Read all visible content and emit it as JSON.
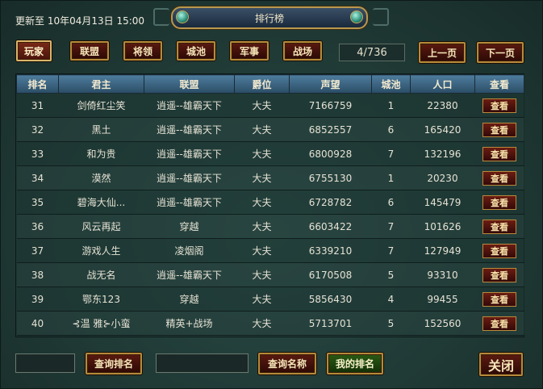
{
  "header": {
    "update_info": "更新至 10年04月13日 15:00",
    "title": "排行榜"
  },
  "tabs": [
    "玩家",
    "联盟",
    "将领",
    "城池",
    "军事",
    "战场"
  ],
  "active_tab": "玩家",
  "pagination": {
    "indicator": "4/736",
    "prev_label": "上一页",
    "next_label": "下一页"
  },
  "table": {
    "columns": [
      "排名",
      "君主",
      "联盟",
      "爵位",
      "声望",
      "城池",
      "人口",
      "查看"
    ],
    "view_label": "查看",
    "rows": [
      {
        "rank": "31",
        "lord": "剑倚红尘笑",
        "alliance": "逍遥--雄霸天下",
        "title": "大夫",
        "prestige": "7166759",
        "cities": "1",
        "population": "22380"
      },
      {
        "rank": "32",
        "lord": "黑土",
        "alliance": "逍遥--雄霸天下",
        "title": "大夫",
        "prestige": "6852557",
        "cities": "6",
        "population": "165420"
      },
      {
        "rank": "33",
        "lord": "和为贵",
        "alliance": "逍遥--雄霸天下",
        "title": "大夫",
        "prestige": "6800928",
        "cities": "7",
        "population": "132196"
      },
      {
        "rank": "34",
        "lord": "漠然",
        "alliance": "逍遥--雄霸天下",
        "title": "大夫",
        "prestige": "6755130",
        "cities": "1",
        "population": "20230"
      },
      {
        "rank": "35",
        "lord": "碧海大仙...",
        "alliance": "逍遥--雄霸天下",
        "title": "大夫",
        "prestige": "6728782",
        "cities": "6",
        "population": "145479"
      },
      {
        "rank": "36",
        "lord": "风云再起",
        "alliance": "穿越",
        "title": "大夫",
        "prestige": "6603422",
        "cities": "7",
        "population": "101626"
      },
      {
        "rank": "37",
        "lord": "游戏人生",
        "alliance": "凌烟阁",
        "title": "大夫",
        "prestige": "6339210",
        "cities": "7",
        "population": "127949"
      },
      {
        "rank": "38",
        "lord": "战无名",
        "alliance": "逍遥--雄霸天下",
        "title": "大夫",
        "prestige": "6170508",
        "cities": "5",
        "population": "93310"
      },
      {
        "rank": "39",
        "lord": "鄂东123",
        "alliance": "穿越",
        "title": "大夫",
        "prestige": "5856430",
        "cities": "4",
        "population": "99455"
      },
      {
        "rank": "40",
        "lord": "⊰温 雅⊱小蛮",
        "alliance": "精英+战场",
        "title": "大夫",
        "prestige": "5713701",
        "cities": "5",
        "population": "152560"
      }
    ]
  },
  "footer": {
    "rank_query_value": "",
    "rank_query_label": "查询排名",
    "name_query_value": "",
    "name_query_label": "查询名称",
    "my_rank_label": "我的排名",
    "close_label": "关闭"
  }
}
